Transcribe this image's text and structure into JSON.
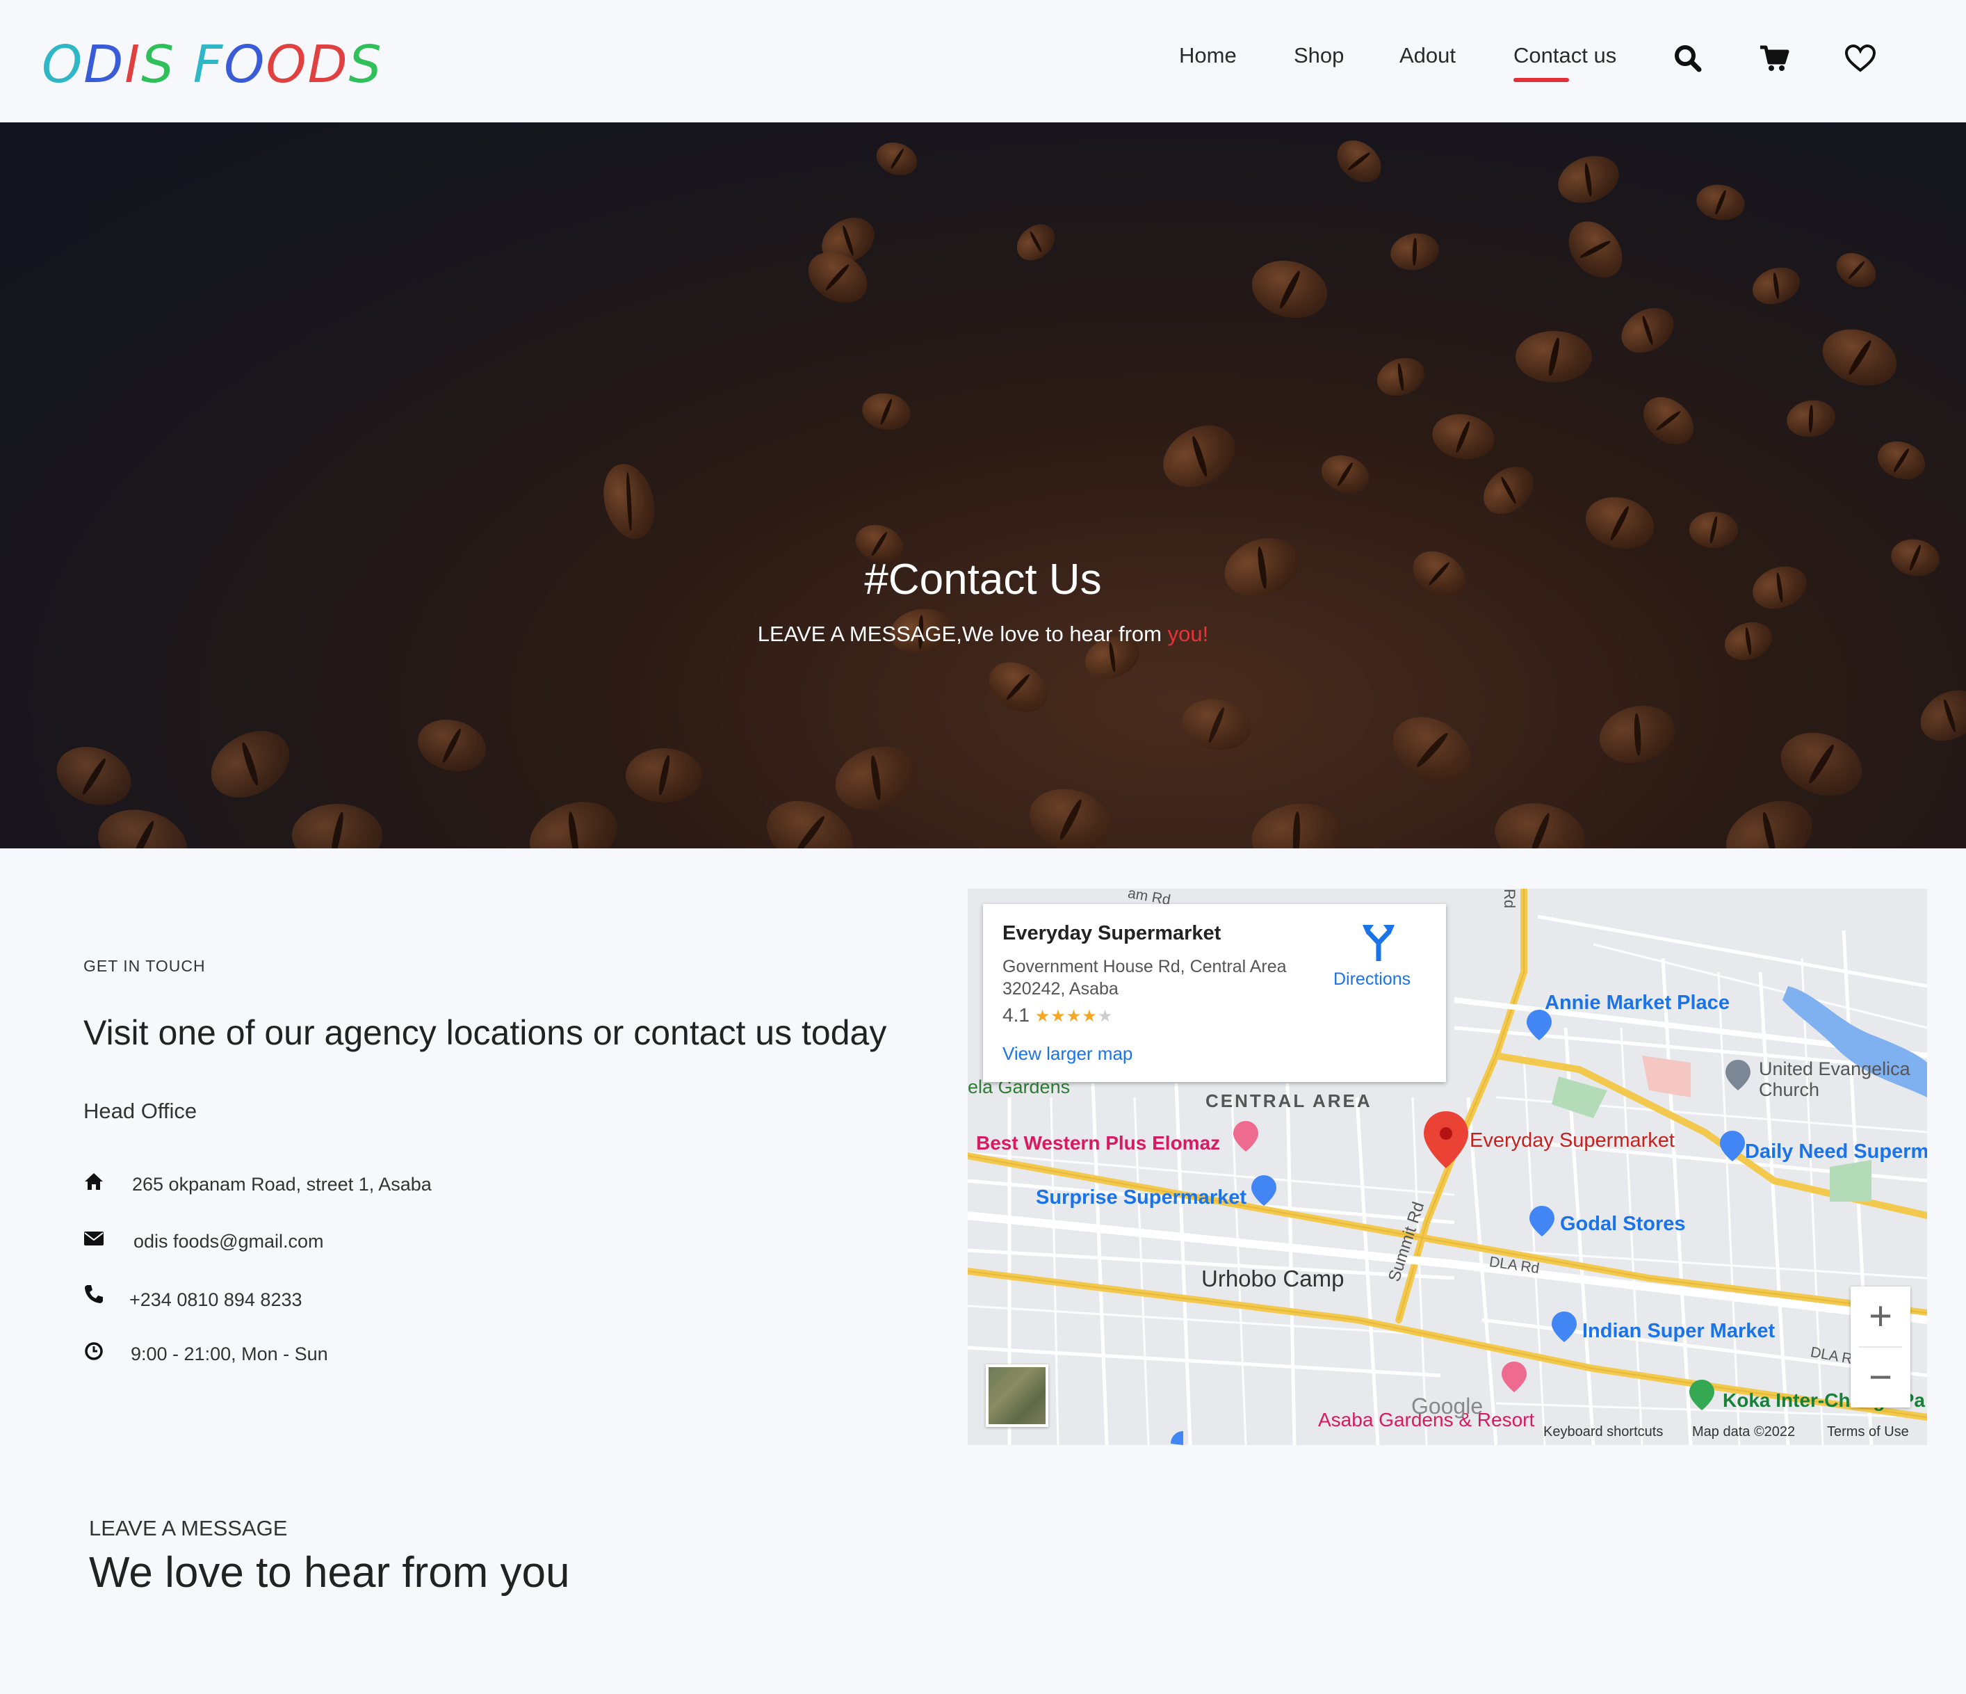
{
  "header": {
    "logo_letters": [
      {
        "ch": "O",
        "color": "#2fb7c8"
      },
      {
        "ch": "D",
        "color": "#3a5bd8"
      },
      {
        "ch": "I",
        "color": "#e04040"
      },
      {
        "ch": "S",
        "color": "#2fc05a"
      },
      {
        "ch": " ",
        "color": "#000000"
      },
      {
        "ch": "F",
        "color": "#2fb7c8"
      },
      {
        "ch": "O",
        "color": "#3a5bd8"
      },
      {
        "ch": "O",
        "color": "#e04040"
      },
      {
        "ch": "D",
        "color": "#e04040"
      },
      {
        "ch": "S",
        "color": "#2fc05a"
      }
    ],
    "nav": {
      "home": "Home",
      "shop": "Shop",
      "about": "Adout",
      "contact": "Contact us"
    },
    "icons": [
      "search-icon",
      "cart-icon",
      "heart-icon"
    ],
    "accent": "#e0313b"
  },
  "hero": {
    "title": "#Contact Us",
    "subtitle_main": "LEAVE A MESSAGE,We love to hear from ",
    "subtitle_highlight": "you!"
  },
  "contact": {
    "eyebrow": "GET IN TOUCH",
    "heading": "Visit one of our agency locations or contact us today",
    "office_label": "Head Office",
    "address": "265 okpanam Road, street 1, Asaba",
    "email": "odis foods@gmail.com",
    "phone": "+234 0810 894 8233",
    "hours": "9:00 - 21:00, Mon - Sun"
  },
  "map": {
    "popup": {
      "name": "Everyday Supermarket",
      "address_line1": "Government House Rd, Central Area",
      "address_line2": "320242, Asaba",
      "rating": "4.1",
      "stars": 4,
      "view_larger": "View larger map",
      "directions": "Directions"
    },
    "labels": {
      "annie": "Annie Market Place",
      "united1": "United Evangelica",
      "united2": "Church",
      "central": "CENTRAL AREA",
      "best_western": "Best Western Plus Elomaz",
      "everyday": "Everyday Supermarket",
      "daily": "Daily Need Superm",
      "surprise": "Surprise Supermarket",
      "godal": "Godal Stores",
      "urhobo": "Urhobo Camp",
      "summit": "Summit Rd",
      "dla": "DLA Rd",
      "dla2": "DLA R",
      "indian": "Indian Super Market",
      "koka": "Koka Inter-Change Pa",
      "asaba_gardens": "Asaba Gardens & Resort",
      "ela_gardens": "ela Gardens",
      "rd_top": "Rd",
      "am_rd": "am Rd",
      "google": "Google"
    },
    "footer": {
      "shortcuts": "Keyboard shortcuts",
      "data": "Map data ©2022",
      "terms": "Terms of Use"
    },
    "zoom_in": "+",
    "zoom_out": "−"
  },
  "message": {
    "eyebrow": "LEAVE A MESSAGE",
    "heading": "We love to hear from you"
  }
}
